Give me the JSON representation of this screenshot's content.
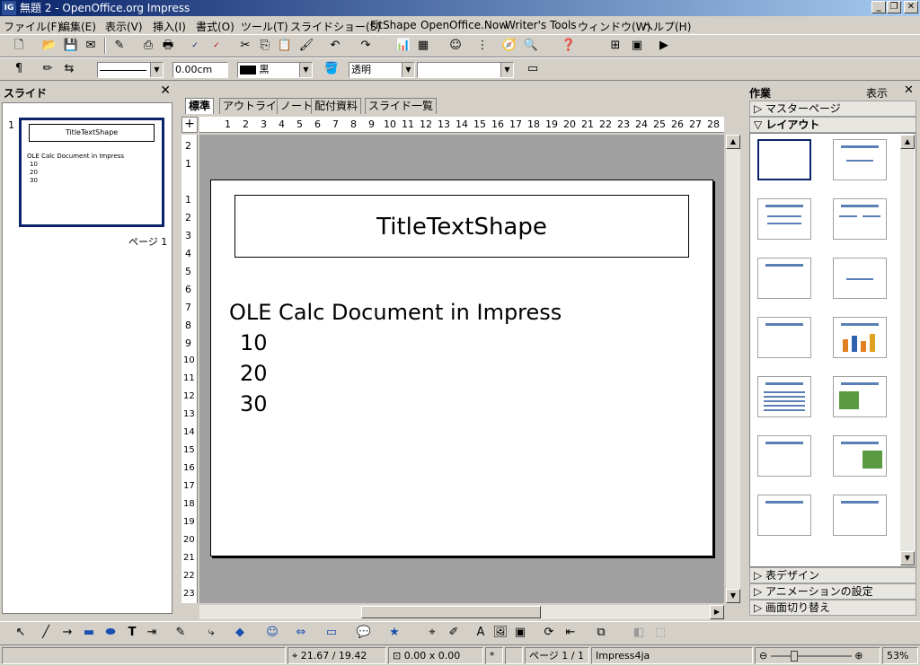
{
  "window": {
    "title": "無題 2 - OpenOffice.org Impress",
    "app_icon": "IG",
    "min_label": "_",
    "max_label": "❐",
    "close_label": "✕"
  },
  "menu": [
    "ファイル(F)",
    "編集(E)",
    "表示(V)",
    "挿入(I)",
    "書式(O)",
    "ツール(T)",
    "スライドショー(S)",
    "FitShape",
    "OpenOffice.Now",
    "Writer's Tools",
    "ウィンドウ(W)",
    "ヘルプ(H)"
  ],
  "format_toolbar": {
    "line_width": "0.00cm",
    "line_color": "黒",
    "fill": "透明"
  },
  "slides_panel": {
    "title": "スライド",
    "close_label": "✕",
    "slide_number": "1",
    "page_label": "ページ 1",
    "thumb_title": "TitleTextShape",
    "thumb_lines": [
      "OLE Calc Document in Impress",
      "10",
      "20",
      "30"
    ]
  },
  "editor": {
    "tabs": [
      "標準",
      "アウトライン",
      "ノート",
      "配付資料",
      "スライド一覧"
    ],
    "hruler_ticks": [
      "1",
      "2",
      "3",
      "4",
      "5",
      "6",
      "7",
      "8",
      "9",
      "10",
      "11",
      "12",
      "13",
      "14",
      "15",
      "16",
      "17",
      "18",
      "19",
      "20",
      "21",
      "22",
      "23",
      "24",
      "25",
      "26",
      "27",
      "28"
    ],
    "vruler_ticks": [
      "2",
      "1",
      "1",
      "2",
      "3",
      "4",
      "5",
      "6",
      "7",
      "8",
      "9",
      "10",
      "11",
      "12",
      "13",
      "14",
      "15",
      "16",
      "17",
      "18",
      "19",
      "20",
      "21",
      "22",
      "23"
    ],
    "slide_title": "TitleTextShape",
    "body_lines": [
      "OLE Calc Document in Impress",
      " 10",
      " 20",
      " 30"
    ]
  },
  "taskpane": {
    "title": "作業",
    "view_label": "表示",
    "close_label": "✕",
    "sections_top": [
      "マスターページ",
      "レイアウト"
    ],
    "sections_bottom": [
      "表デザイン",
      "アニメーションの設定",
      "画面切り替え"
    ]
  },
  "statusbar": {
    "position": "21.67 / 19.42",
    "size": "0.00 x 0.00",
    "page": "ページ 1 / 1",
    "style": "Impress4ja",
    "zoom": "53%"
  },
  "colors": {
    "title_bar": "#0a246a",
    "selection": "#0a246a",
    "canvas": "#a0a0a0",
    "chrome": "#d4d0c8"
  }
}
